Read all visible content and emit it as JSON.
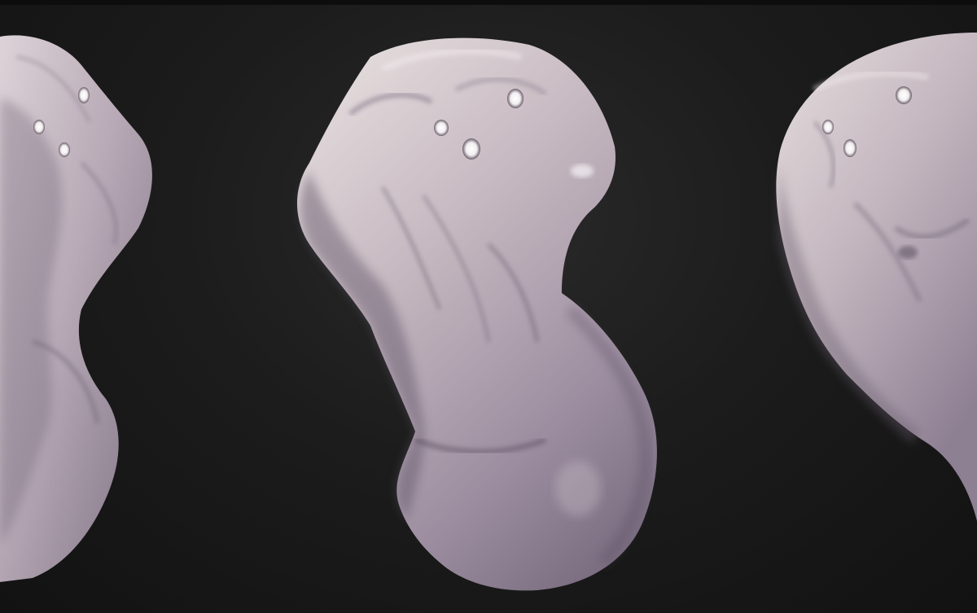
{
  "scene": {
    "background_color": "#141414",
    "material_color": "#b7a9b6",
    "material_shadow_color": "#6f6373",
    "material_highlight_color": "#e6dde2",
    "views": [
      {
        "name": "left-view",
        "orientation": "profile-right",
        "cropped": "left"
      },
      {
        "name": "center-view",
        "orientation": "three-quarter",
        "cropped": "none"
      },
      {
        "name": "right-view",
        "orientation": "three-quarter-left",
        "cropped": "right"
      }
    ]
  }
}
